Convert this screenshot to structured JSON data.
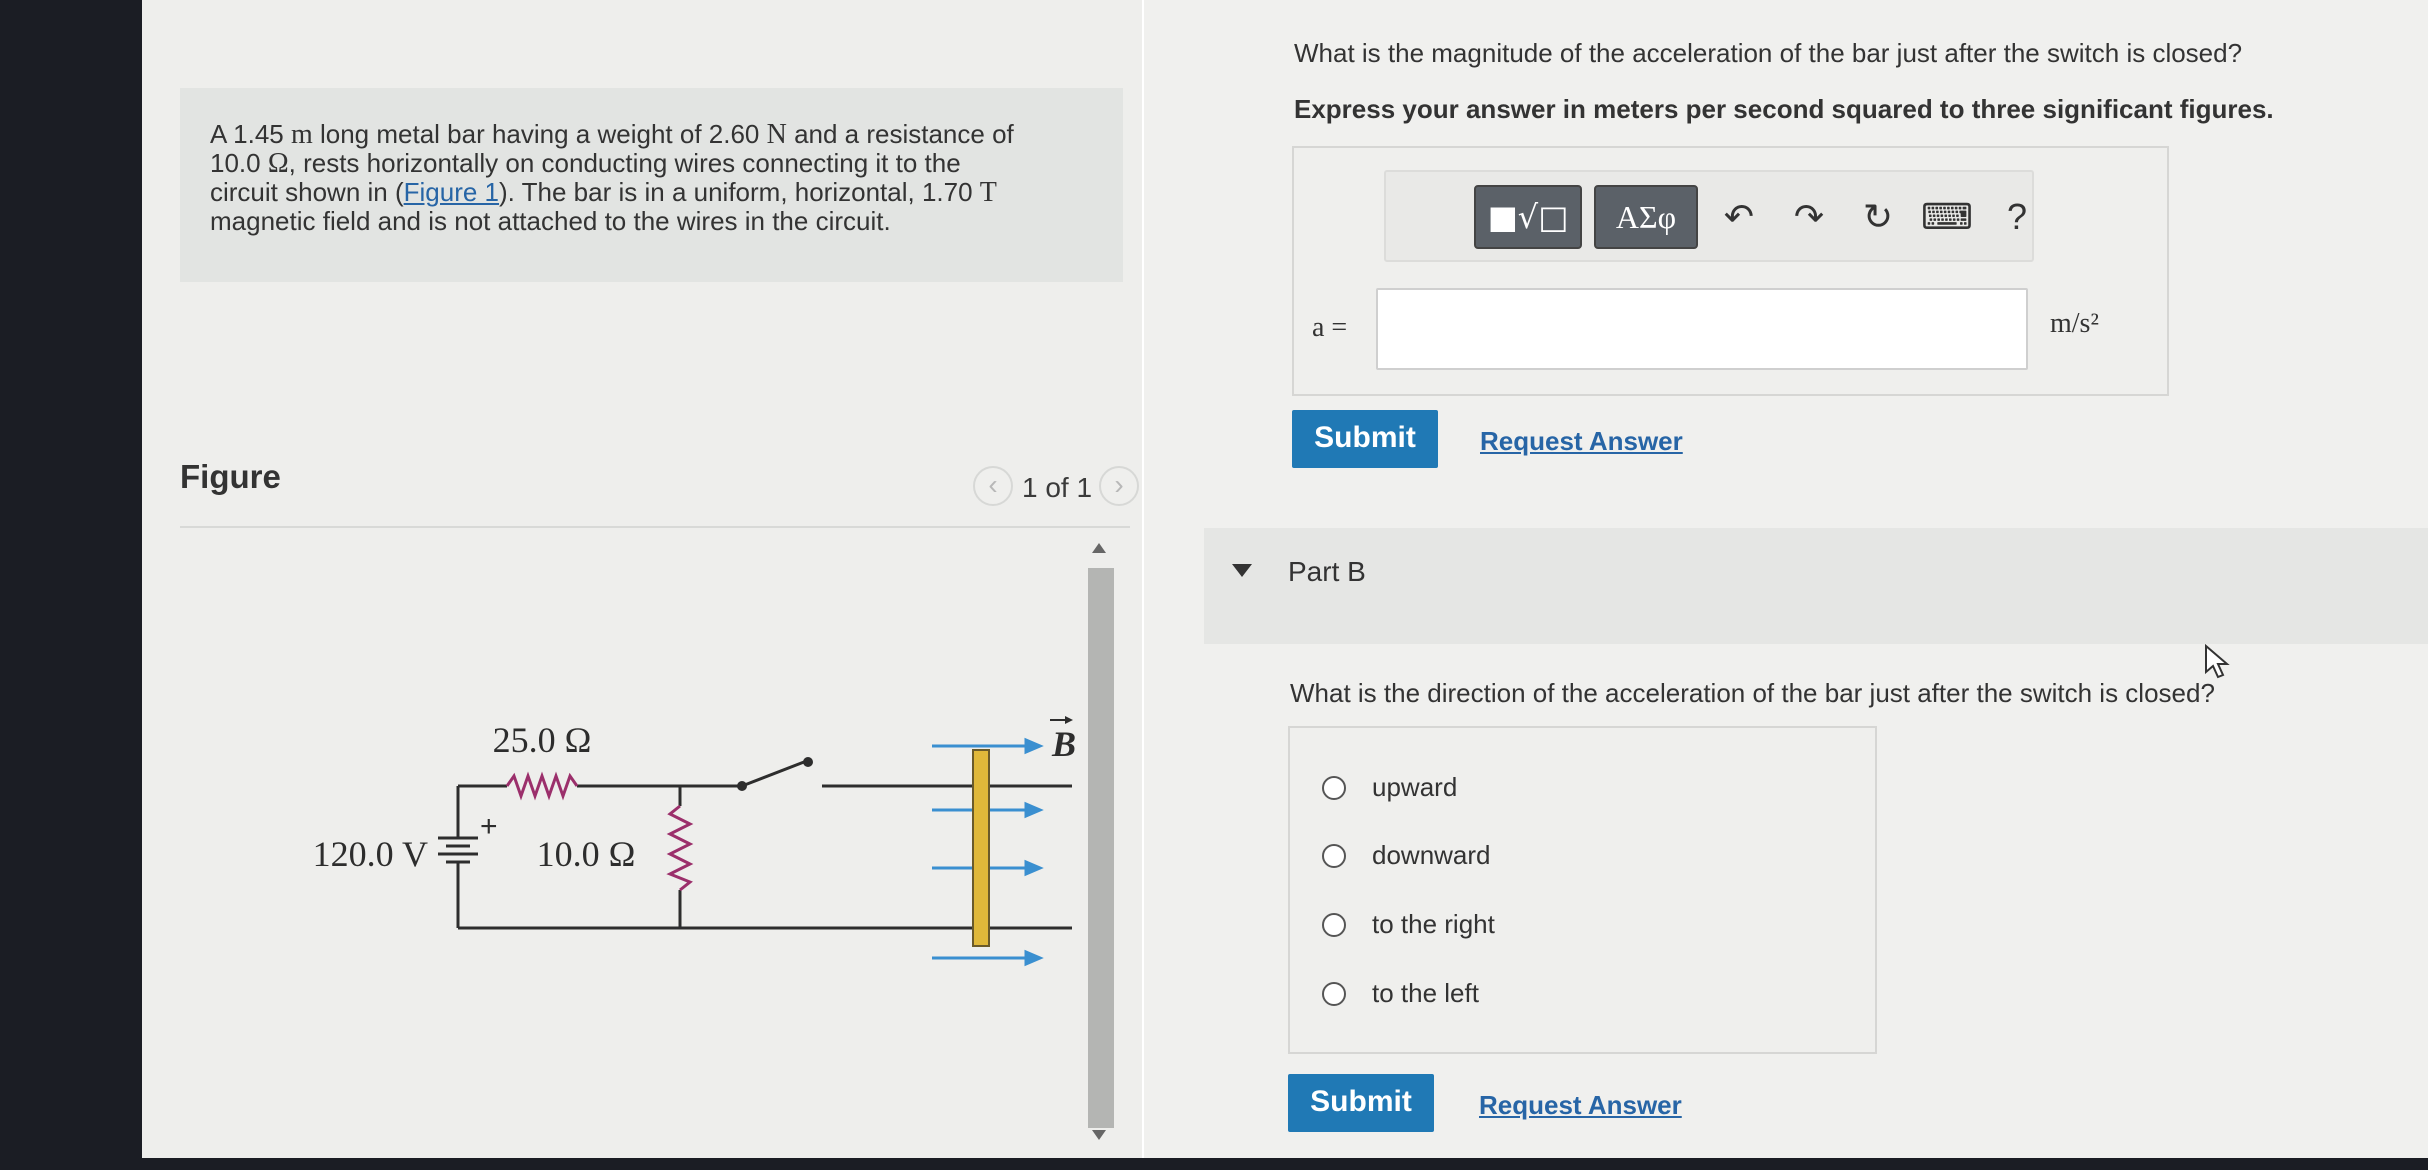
{
  "problem": {
    "t1": "A 1.45 ",
    "u1": "m",
    "t2": " long metal bar having a weight of 2.60 ",
    "u2": "N",
    "t3": " and a resistance of",
    "t4": "10.0 ",
    "u3": "Ω",
    "t5": ", rests horizontally on conducting wires connecting it to the",
    "t6": "circuit shown in (",
    "link": "Figure 1",
    "t7": "). The bar is in a uniform, horizontal, 1.70 ",
    "u4": "T",
    "t8": "magnetic field and is not attached to the wires in the circuit."
  },
  "figure": {
    "title": "Figure",
    "count": "1 of 1",
    "prev_icon": "chevron-left-icon",
    "next_icon": "chevron-right-icon",
    "labels": {
      "r1": "25.0 Ω",
      "r2": "10.0 Ω",
      "voltage": "120.0 V",
      "plus": "+",
      "field": "B"
    }
  },
  "partA": {
    "question": "What is the magnitude of the acceleration of the bar just after the switch is closed?",
    "instruction": "Express your answer in meters per second squared to three significant figures.",
    "toolbar": {
      "template": "■√□",
      "greek": "ΑΣφ",
      "undo": "↶",
      "redo": "↷",
      "reset": "↻",
      "keyboard": "⌨",
      "help": "?"
    },
    "input_label": "a =",
    "input_value": "",
    "unit": "m/s²",
    "submit": "Submit",
    "request": "Request Answer"
  },
  "partB": {
    "title": "Part B",
    "question": "What is the direction of the acceleration of the bar just after the switch is closed?",
    "options": [
      "upward",
      "downward",
      "to the right",
      "to the left"
    ],
    "submit": "Submit",
    "request": "Request Answer"
  },
  "colors": {
    "accent": "#2079b5",
    "link": "#2765a6",
    "resistor": "#9b2f6b",
    "bar": "#e0b83a",
    "field_arrow": "#3a8fd0"
  }
}
